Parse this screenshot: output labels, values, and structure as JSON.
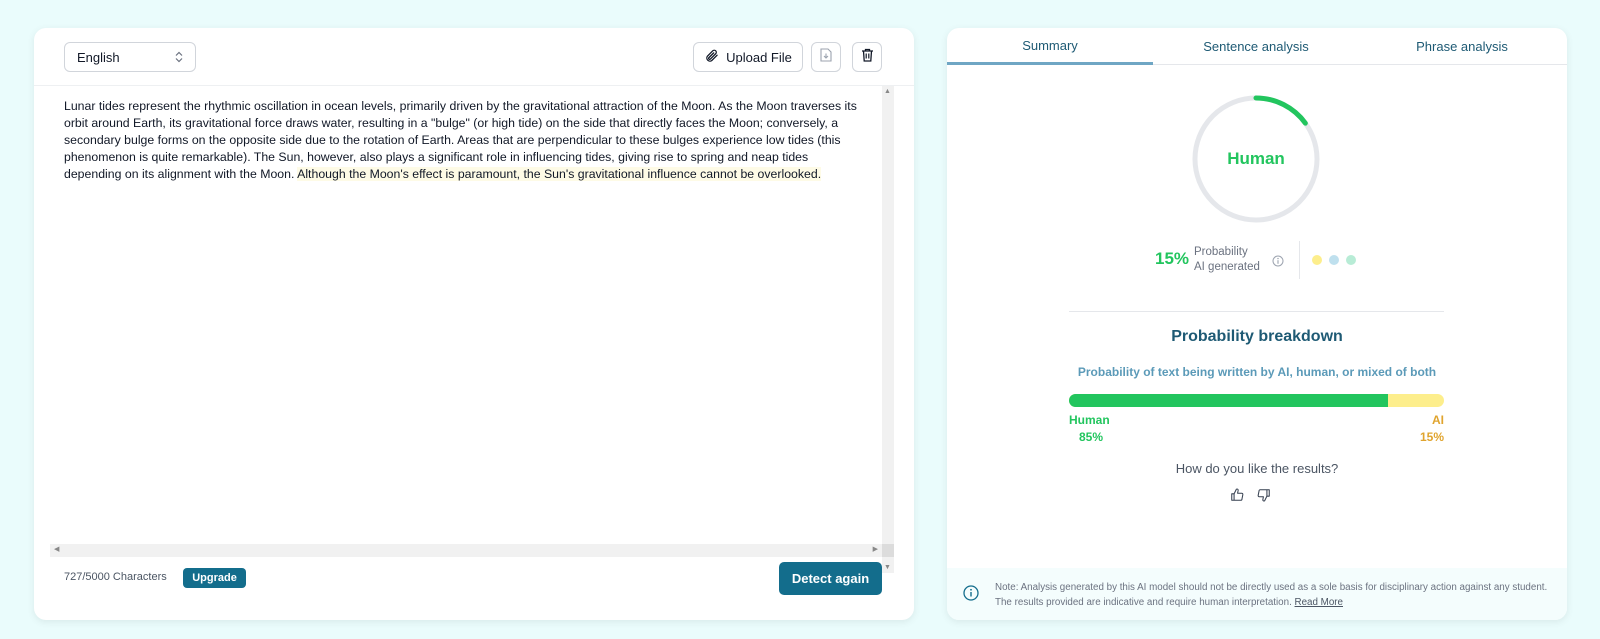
{
  "editor": {
    "language": "English",
    "upload_label": "Upload File",
    "text_plain": "Lunar tides represent the rhythmic oscillation in ocean levels, primarily driven by the gravitational attraction of the Moon. As the Moon traverses its orbit around Earth, its gravitational force draws water, resulting in a \"bulge\" (or high tide) on the side that directly faces the Moon; conversely, a secondary bulge forms on the opposite side due to the rotation of Earth. Areas that are perpendicular to these bulges experience low tides (this phenomenon is quite remarkable). The Sun, however, also plays a significant role in influencing tides, giving rise to spring and neap tides depending on its alignment with the Moon. ",
    "text_highlighted": "Although the Moon's effect is paramount, the Sun's gravitational influence cannot be overlooked.",
    "char_count": "727/5000 Characters",
    "upgrade_label": "Upgrade",
    "detect_label": "Detect again"
  },
  "results": {
    "tabs": [
      {
        "label": "Summary",
        "active": true
      },
      {
        "label": "Sentence analysis",
        "active": false
      },
      {
        "label": "Phrase analysis",
        "active": false
      }
    ],
    "verdict": "Human",
    "ai_percent_text": "15%",
    "ai_fraction": 0.15,
    "ai_label_line1": "Probability",
    "ai_label_line2": "AI generated",
    "legend_dot_colors": [
      "#fdee8c",
      "#bfe0ee",
      "#b8ecd6"
    ],
    "breakdown_title": "Probability breakdown",
    "breakdown_subtitle": "Probability of text being written by AI, human, or mixed of both",
    "human_label": "Human",
    "human_percent_text": "85%",
    "human_fraction": 0.85,
    "ai_label": "AI",
    "ai_percent_text_bar": "15%",
    "feedback_question": "How do you like the results?",
    "note_text": "Note: Analysis generated by this AI model should not be directly used as a sole basis for disciplinary action against any student. The results provided are indicative and require human interpretation. ",
    "note_link": "Read More"
  },
  "colors": {
    "accent": "#136d8c",
    "human_green": "#22c55e",
    "ai_yellow": "#fdee8c",
    "ai_text": "#e0a42e"
  }
}
